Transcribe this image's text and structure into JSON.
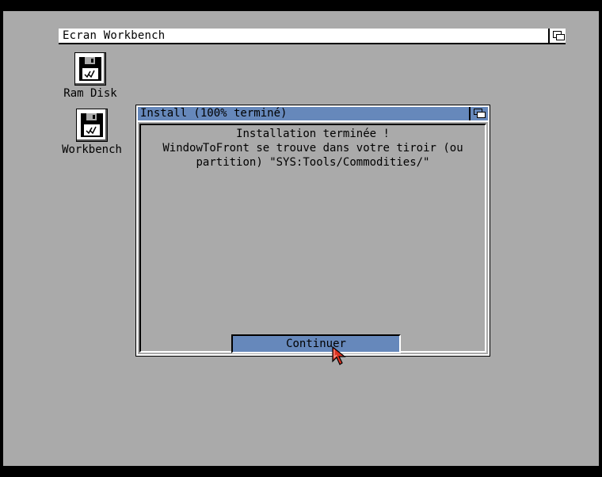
{
  "screen": {
    "title": "Ecran Workbench"
  },
  "desktop_icons": [
    {
      "label": "Ram Disk",
      "icon": "floppy-disk-icon"
    },
    {
      "label": "Workbench",
      "icon": "floppy-disk-icon"
    }
  ],
  "install_window": {
    "title": "Install (100% terminé)",
    "message": "Installation terminée !\nWindowToFront se trouve dans votre tiroir (ou\npartition) \"SYS:Tools/Commodities/\"",
    "continue_label": "Continuer"
  },
  "colors": {
    "desktop": "#aaaaaa",
    "title_bar_active": "#6688bb",
    "pointer": "#dd3322"
  }
}
